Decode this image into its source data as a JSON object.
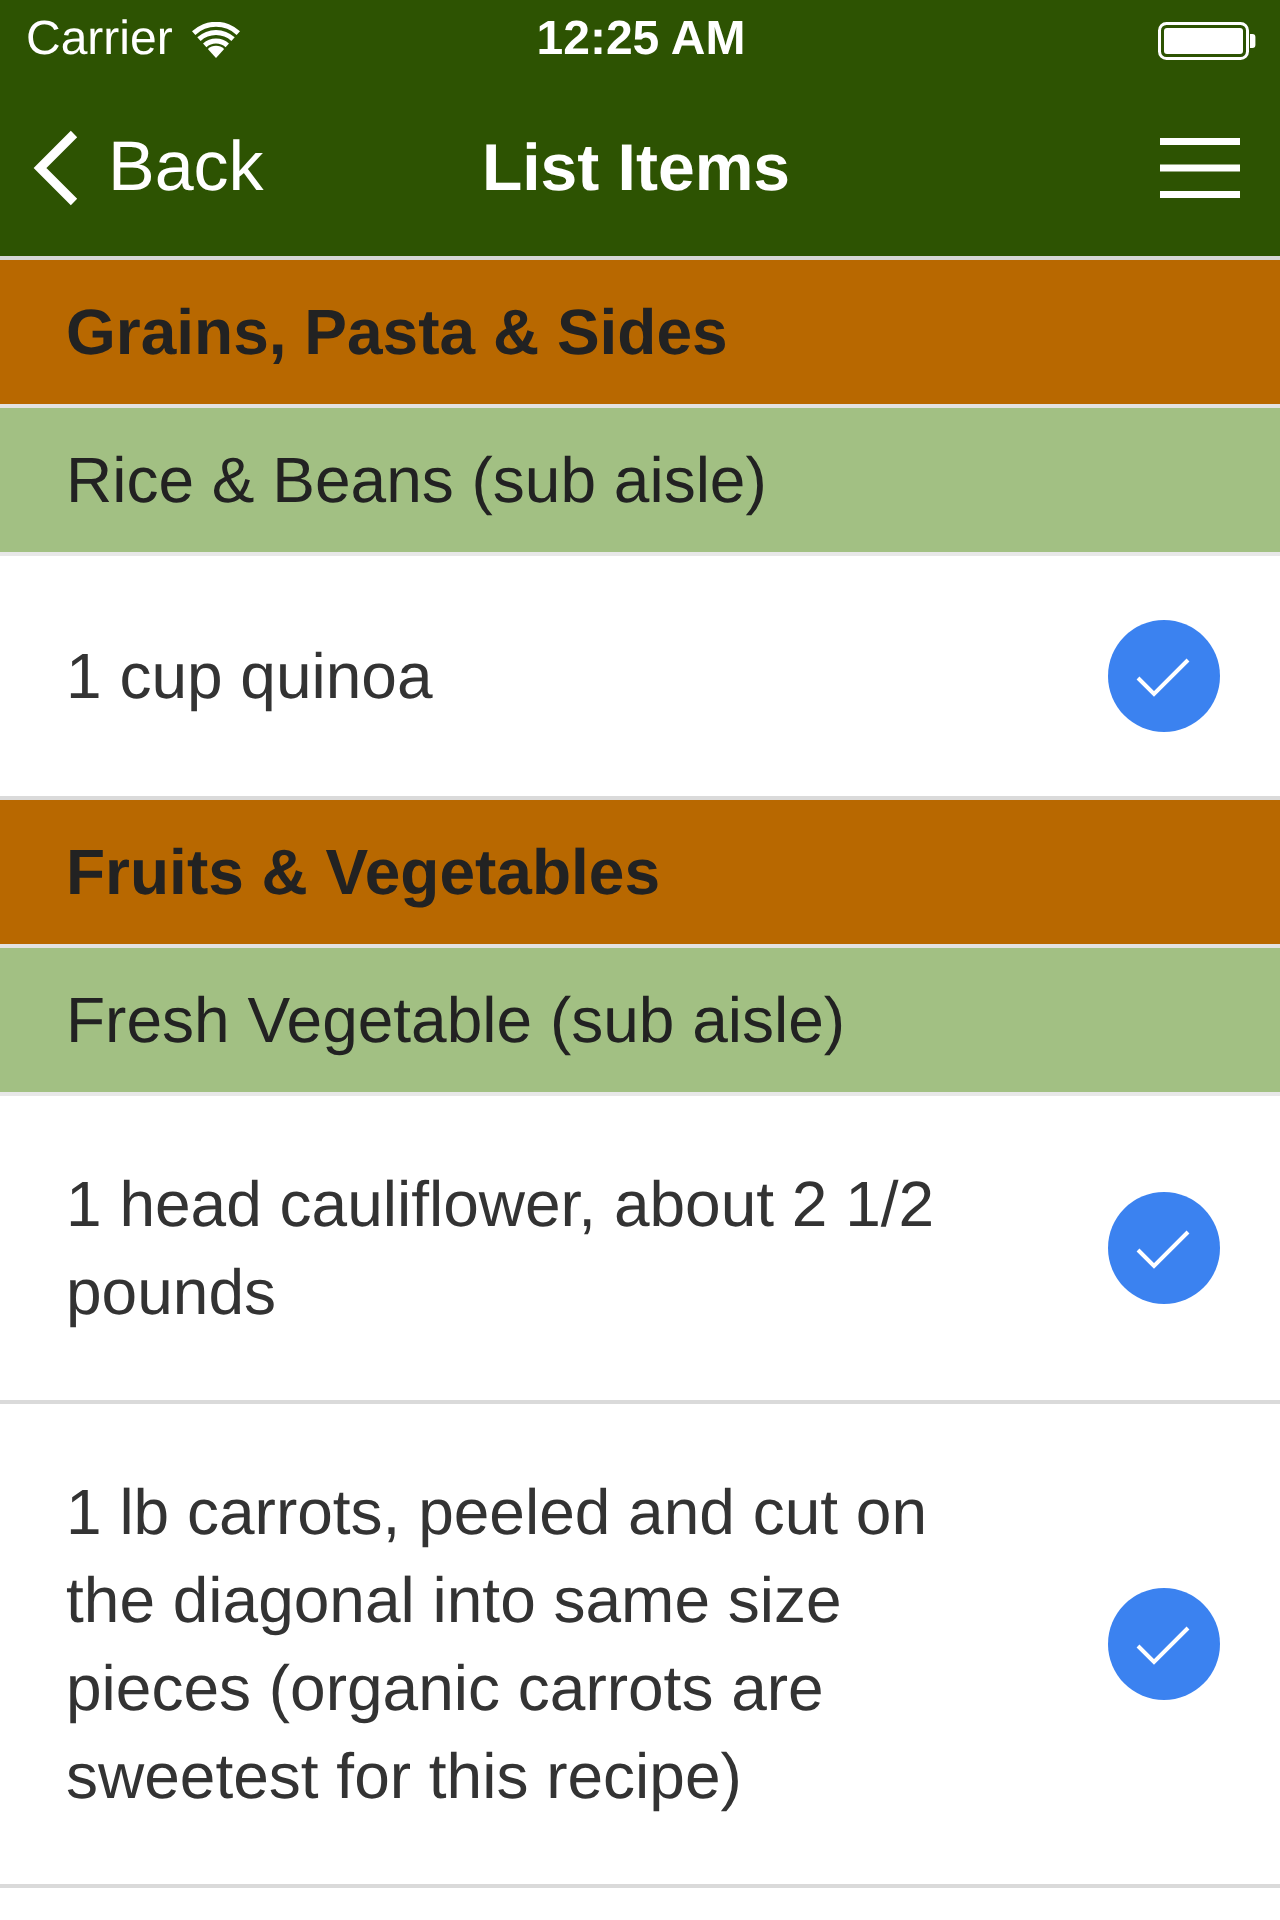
{
  "status_bar": {
    "carrier": "Carrier",
    "time": "12:25 AM"
  },
  "nav_bar": {
    "back_label": "Back",
    "title": "List Items"
  },
  "aisles": [
    {
      "name": "Grains, Pasta & Sides",
      "sub_aisles": [
        {
          "name": "Rice & Beans (sub aisle)",
          "items": [
            {
              "text": "1 cup quinoa",
              "checked": true
            }
          ]
        }
      ]
    },
    {
      "name": "Fruits & Vegetables",
      "sub_aisles": [
        {
          "name": "Fresh Vegetable (sub aisle)",
          "items": [
            {
              "text": "1 head cauliflower, about 2 1/2 pounds",
              "checked": true
            },
            {
              "text": "1 lb carrots, peeled and cut on the diagonal into same size pieces (organic carrots are sweetest for this recipe)",
              "checked": true
            }
          ]
        }
      ]
    }
  ]
}
